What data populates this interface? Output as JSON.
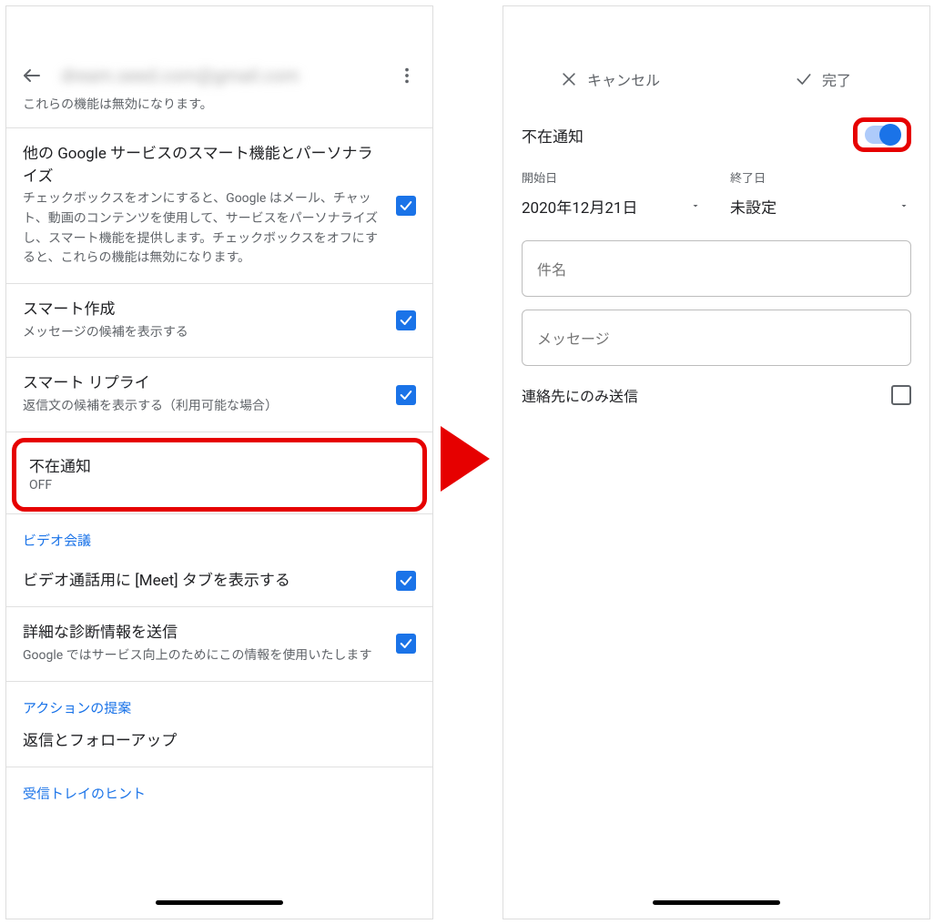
{
  "left": {
    "header_email": "dream.seed.com@gmail.com",
    "disabled_note": "これらの機能は無効になります。",
    "item_other_services_title": "他の Google サービスのスマート機能とパーソナライズ",
    "item_other_services_desc": "チェックボックスをオンにすると、Google はメール、チャット、動画のコンテンツを使用して、サービスをパーソナライズし、スマート機能を提供します。チェックボックスをオフにすると、これらの機能は無効になります。",
    "item_smart_compose_title": "スマート作成",
    "item_smart_compose_desc": "メッセージの候補を表示する",
    "item_smart_reply_title": "スマート リプライ",
    "item_smart_reply_desc": "返信文の候補を表示する（利用可能な場合）",
    "item_ooo_title": "不在通知",
    "item_ooo_state": "OFF",
    "section_video": "ビデオ会議",
    "item_meet_tab_title": "ビデオ通話用に [Meet] タブを表示する",
    "item_diag_title": "詳細な診断情報を送信",
    "item_diag_desc": "Google ではサービス向上のためにこの情報を使用いたします",
    "section_action": "アクションの提案",
    "item_reply_follow": "返信とフォローアップ",
    "section_inbox_tips": "受信トレイのヒント"
  },
  "right": {
    "cancel_label": "キャンセル",
    "done_label": "完了",
    "ooo_label": "不在通知",
    "start_label": "開始日",
    "start_value": "2020年12月21日",
    "end_label": "終了日",
    "end_value": "未設定",
    "subject_placeholder": "件名",
    "message_placeholder": "メッセージ",
    "contacts_only_label": "連絡先にのみ送信"
  }
}
